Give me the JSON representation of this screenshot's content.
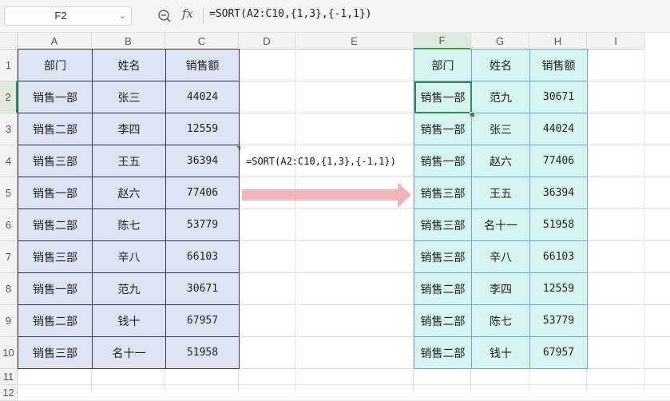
{
  "name_box": {
    "value": "F2"
  },
  "formula_bar": {
    "formula": "=SORT(A2:C10,{1,3},{-1,1})",
    "fx_label": "fx"
  },
  "columns": [
    "A",
    "B",
    "C",
    "D",
    "E",
    "F",
    "G",
    "H",
    "I"
  ],
  "rows": [
    "1",
    "2",
    "3",
    "4",
    "5",
    "6",
    "7",
    "8",
    "9",
    "10",
    "11",
    "12"
  ],
  "selected_cell": "F2",
  "source_table": {
    "headers": [
      "部门",
      "姓名",
      "销售额"
    ],
    "rows": [
      [
        "销售一部",
        "张三",
        "44024"
      ],
      [
        "销售二部",
        "李四",
        "12559"
      ],
      [
        "销售三部",
        "王五",
        "36394"
      ],
      [
        "销售一部",
        "赵六",
        "77406"
      ],
      [
        "销售二部",
        "陈七",
        "53779"
      ],
      [
        "销售三部",
        "辛八",
        "66103"
      ],
      [
        "销售一部",
        "范九",
        "30671"
      ],
      [
        "销售二部",
        "钱十",
        "67957"
      ],
      [
        "销售三部",
        "名十一",
        "51958"
      ]
    ]
  },
  "annotation": {
    "formula_note": "=SORT(A2:C10,{1,3},{-1,1})"
  },
  "result_table": {
    "headers": [
      "部门",
      "姓名",
      "销售额"
    ],
    "rows": [
      [
        "销售一部",
        "范九",
        "30671"
      ],
      [
        "销售一部",
        "张三",
        "44024"
      ],
      [
        "销售一部",
        "赵六",
        "77406"
      ],
      [
        "销售三部",
        "王五",
        "36394"
      ],
      [
        "销售三部",
        "名十一",
        "51958"
      ],
      [
        "销售三部",
        "辛八",
        "66103"
      ],
      [
        "销售二部",
        "李四",
        "12559"
      ],
      [
        "销售二部",
        "陈七",
        "53779"
      ],
      [
        "销售二部",
        "钱十",
        "67957"
      ]
    ]
  },
  "colors": {
    "source_fill": "#dde3f3",
    "result_fill": "#d5f3ef",
    "arrow": "#f1b3be",
    "selection": "#2e8b57"
  }
}
